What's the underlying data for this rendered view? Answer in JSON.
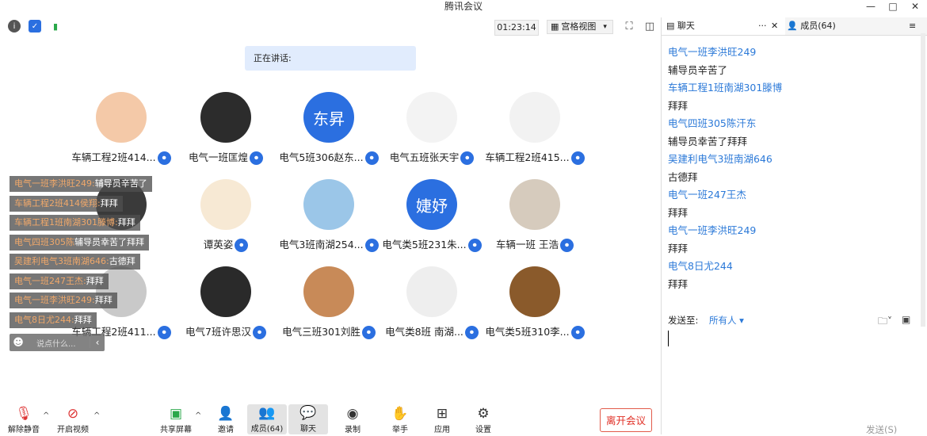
{
  "window": {
    "title": "腾讯会议",
    "minimize": "—",
    "maximize": "□",
    "close": "✕"
  },
  "topbar": {
    "timer": "01:23:14",
    "view_label": "宫格视图",
    "view_caret": "▾"
  },
  "speaking": {
    "label": "正在讲话:"
  },
  "participants": [
    {
      "name": "车辆工程2班414...",
      "avatar_text": "",
      "avatar_bg": "#f4c9a8"
    },
    {
      "name": "电气一班匡煌",
      "avatar_text": "",
      "avatar_bg": "#2c2c2c"
    },
    {
      "name": "电气5班306赵东...",
      "avatar_text": "东昇",
      "avatar_bg": "#2b6fe0"
    },
    {
      "name": "电气五班张天宇",
      "avatar_text": "",
      "avatar_bg": "#f3f3f3"
    },
    {
      "name": "车辆工程2班415...",
      "avatar_text": "",
      "avatar_bg": "#f2f2f2"
    },
    {
      "name": "",
      "avatar_text": "",
      "avatar_bg": "#3a3a3a"
    },
    {
      "name": "谭英姿",
      "avatar_text": "",
      "avatar_bg": "#f7e9d4"
    },
    {
      "name": "电气3班南湖254...",
      "avatar_text": "",
      "avatar_bg": "#9bc6e8"
    },
    {
      "name": "电气类5班231朱...",
      "avatar_text": "婕妤",
      "avatar_bg": "#2b6fe0"
    },
    {
      "name": "车辆一班 王浩",
      "avatar_text": "",
      "avatar_bg": "#d6cbbd"
    },
    {
      "name": "车辆工程2班411...",
      "avatar_text": "",
      "avatar_bg": "#c9c9c9"
    },
    {
      "name": "电气7班许思汉",
      "avatar_text": "",
      "avatar_bg": "#2a2a2a"
    },
    {
      "name": "电气三班301刘胜",
      "avatar_text": "",
      "avatar_bg": "#c88a58"
    },
    {
      "name": "电气类8班  南湖...",
      "avatar_text": "",
      "avatar_bg": "#eeeeee"
    },
    {
      "name": "电气类5班310李...",
      "avatar_text": "",
      "avatar_bg": "#8a5a2b"
    }
  ],
  "danmu": [
    {
      "name": "电气一班李洪旺249:",
      "text": "辅导员辛苦了"
    },
    {
      "name": "车辆工程2班414侯翔:",
      "text": "拜拜"
    },
    {
      "name": "车辆工程1班南湖301滕博:",
      "text": "拜拜"
    },
    {
      "name": "电气四班305陈",
      "text": "辅导员幸苦了拜拜"
    },
    {
      "name": "吴建利电气3班南湖646:",
      "text": "古德拜"
    },
    {
      "name": "电气一班247王杰:",
      "text": "拜拜"
    },
    {
      "name": "电气一班李洪旺249:",
      "text": "拜拜"
    },
    {
      "name": "电气8日尤244:",
      "text": "拜拜"
    }
  ],
  "danmu_input": {
    "placeholder": "说点什么..."
  },
  "toolbar": {
    "mute": "解除静音",
    "video": "开启视频",
    "share": "共享屏幕",
    "invite": "邀请",
    "members": "成员(64)",
    "chat": "聊天",
    "record": "录制",
    "hand": "举手",
    "apps": "应用",
    "settings": "设置",
    "leave": "离开会议"
  },
  "sidebar": {
    "chat_tab": "聊天",
    "members_tab": "成员(64)",
    "more": "···",
    "close": "✕",
    "messages": [
      {
        "type": "name",
        "text": "电气一班李洪旺249"
      },
      {
        "type": "text",
        "text": "辅导员辛苦了"
      },
      {
        "type": "name",
        "text": "车辆工程1班南湖301滕博"
      },
      {
        "type": "text",
        "text": "拜拜"
      },
      {
        "type": "name",
        "text": "电气四班305陈汗东"
      },
      {
        "type": "text",
        "text": "辅导员幸苦了拜拜"
      },
      {
        "type": "name",
        "text": "吴建利电气3班南湖646"
      },
      {
        "type": "text",
        "text": "古德拜"
      },
      {
        "type": "name",
        "text": "电气一班247王杰"
      },
      {
        "type": "text",
        "text": "拜拜"
      },
      {
        "type": "name",
        "text": "电气一班李洪旺249"
      },
      {
        "type": "text",
        "text": "拜拜"
      },
      {
        "type": "name",
        "text": "电气8日尤244"
      },
      {
        "type": "text",
        "text": "拜拜"
      }
    ],
    "send_to_label": "发送至:",
    "send_to_value": "所有人 ▾",
    "send_button": "发送(S)"
  }
}
